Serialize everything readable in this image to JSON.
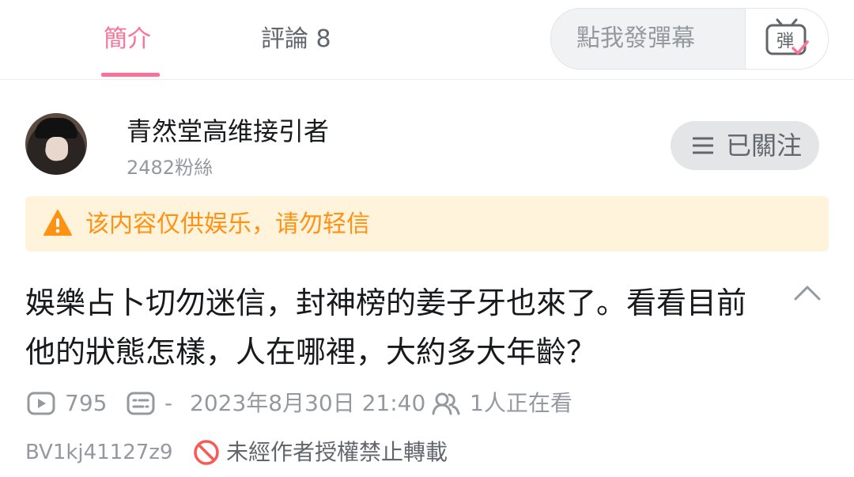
{
  "tabs": {
    "intro": "簡介",
    "comments": "評論 8"
  },
  "danmaku": {
    "placeholder": "點我發彈幕",
    "button_label": "弾"
  },
  "author": {
    "name": "青然堂高维接引者",
    "fans": "2482粉絲",
    "follow_label": "已關注"
  },
  "warning": {
    "text": "该内容仅供娱乐，请勿轻信"
  },
  "video": {
    "title": "娛樂占卜切勿迷信，封神榜的姜子牙也來了。看看目前他的狀態怎樣，人在哪裡，大約多大年齡？",
    "plays": "795",
    "danmaku_count": "-",
    "date": "2023年8月30日 21:40",
    "watching": "1人正在看",
    "bvid": "BV1kj41127z9",
    "copyright": "未經作者授權禁止轉載"
  },
  "colors": {
    "accent": "#fb7299",
    "warning_text": "#ff9212",
    "warning_bg": "#fff3dc",
    "forbidden": "#f85a54"
  },
  "icons": {
    "danmaku": "danmaku-tv-icon",
    "follow": "menu-icon",
    "warning": "warning-triangle-icon",
    "collapse": "chevron-up-icon",
    "plays": "play-icon",
    "danmaku_count": "danmaku-list-icon",
    "watching": "people-icon",
    "copyright": "forbidden-icon"
  }
}
